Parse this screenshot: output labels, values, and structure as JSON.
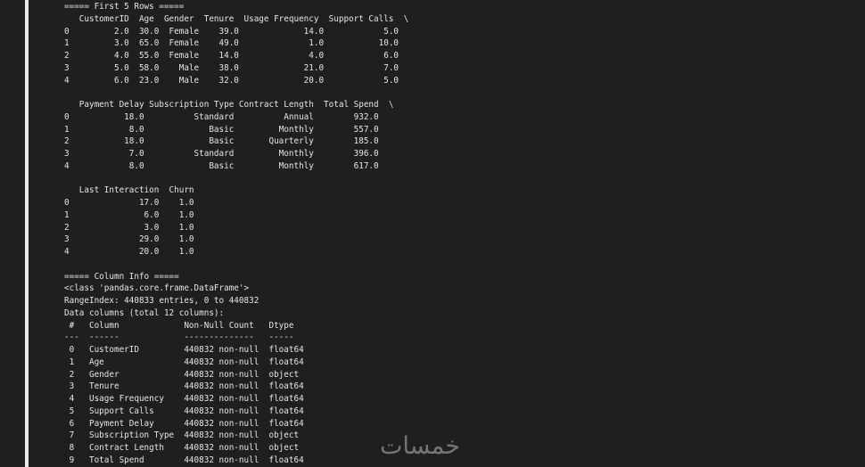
{
  "console": {
    "lines": [
      "===== First 5 Rows =====",
      "   CustomerID  Age  Gender  Tenure  Usage Frequency  Support Calls  \\",
      "0         2.0  30.0  Female    39.0             14.0            5.0",
      "1         3.0  65.0  Female    49.0              1.0           10.0",
      "2         4.0  55.0  Female    14.0              4.0            6.0",
      "3         5.0  58.0    Male    38.0             21.0            7.0",
      "4         6.0  23.0    Male    32.0             20.0            5.0",
      "",
      "   Payment Delay Subscription Type Contract Length  Total Spend  \\",
      "0           18.0          Standard          Annual        932.0",
      "1            8.0             Basic         Monthly        557.0",
      "2           18.0             Basic       Quarterly        185.0",
      "3            7.0          Standard         Monthly        396.0",
      "4            8.0             Basic         Monthly        617.0",
      "",
      "   Last Interaction  Churn",
      "0              17.0    1.0",
      "1               6.0    1.0",
      "2               3.0    1.0",
      "3              29.0    1.0",
      "4              20.0    1.0",
      "",
      "===== Column Info =====",
      "<class 'pandas.core.frame.DataFrame'>",
      "RangeIndex: 440833 entries, 0 to 440832",
      "Data columns (total 12 columns):",
      " #   Column             Non-Null Count   Dtype  ",
      "---  ------             --------------   -----  ",
      " 0   CustomerID         440832 non-null  float64",
      " 1   Age                440832 non-null  float64",
      " 2   Gender             440832 non-null  object ",
      " 3   Tenure             440832 non-null  float64",
      " 4   Usage Frequency    440832 non-null  float64",
      " 5   Support Calls      440832 non-null  float64",
      " 6   Payment Delay      440832 non-null  float64",
      " 7   Subscription Type  440832 non-null  object ",
      " 8   Contract Length    440832 non-null  object ",
      " 9   Total Spend        440832 non-null  float64"
    ]
  },
  "watermark": {
    "text": "خمسات"
  },
  "colors": {
    "background": "#1f1f1f",
    "text": "#e6e6e6",
    "gutter_line": "#e9e9e9",
    "watermark": "#8c8c8c"
  }
}
